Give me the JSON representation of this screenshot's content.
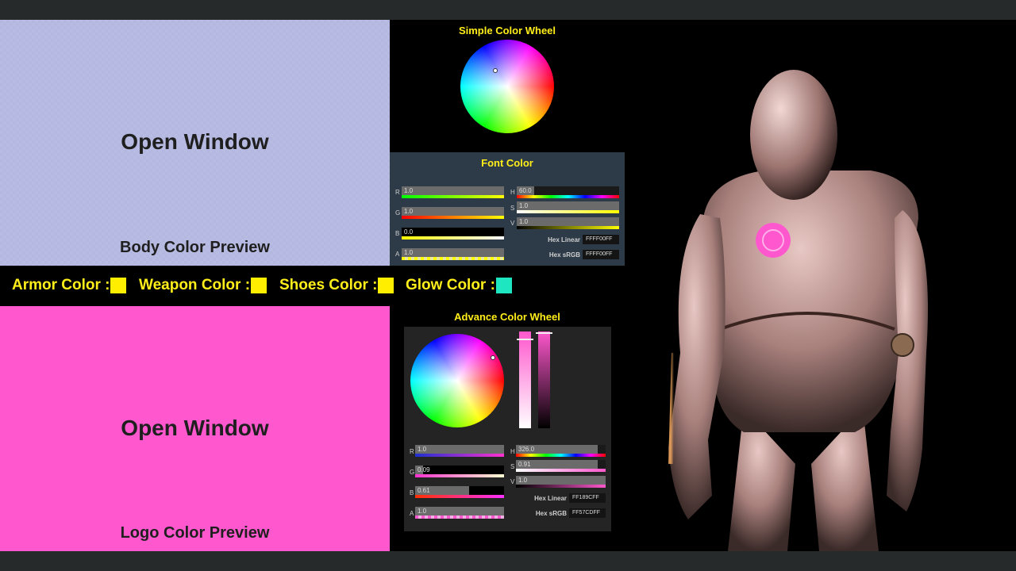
{
  "colors": {
    "body": "#b4b8e0",
    "logo": "#ff57cd",
    "label_yellow": "#ffee1a",
    "armor": "#ffee00",
    "weapon": "#ffee00",
    "shoes": "#ffee00",
    "glow": "#1ee6c0"
  },
  "body_preview": {
    "button": "Open Window",
    "label": "Body Color Preview"
  },
  "logo_preview": {
    "button": "Open Window",
    "label": "Logo Color Preview"
  },
  "swatches": [
    {
      "label": "Armor Color :"
    },
    {
      "label": "Weapon Color :"
    },
    {
      "label": "Shoes Color :"
    },
    {
      "label": "Glow Color :"
    }
  ],
  "simple_wheel": {
    "title": "Simple Color Wheel"
  },
  "font_color": {
    "title": "Font Color",
    "rgba": [
      {
        "letter": "R",
        "value": "1.0",
        "level": 1.0
      },
      {
        "letter": "G",
        "value": "1.0",
        "level": 1.0
      },
      {
        "letter": "B",
        "value": "0.0",
        "level": 0.0
      },
      {
        "letter": "A",
        "value": "1.0",
        "level": 1.0
      }
    ],
    "hsv": [
      {
        "letter": "H",
        "value": "60.0",
        "level": 0.17
      },
      {
        "letter": "S",
        "value": "1.0",
        "level": 1.0
      },
      {
        "letter": "V",
        "value": "1.0",
        "level": 1.0
      }
    ],
    "hex_linear_label": "Hex Linear",
    "hex_linear": "FFFF00FF",
    "hex_srgb_label": "Hex sRGB",
    "hex_srgb": "FFFF00FF"
  },
  "advance_wheel": {
    "title": "Advance Color Wheel",
    "rgba": [
      {
        "letter": "R",
        "value": "1.0",
        "level": 1.0
      },
      {
        "letter": "G",
        "value": "0.09",
        "level": 0.09
      },
      {
        "letter": "B",
        "value": "0.61",
        "level": 0.61
      },
      {
        "letter": "A",
        "value": "1.0",
        "level": 1.0
      }
    ],
    "hsv": [
      {
        "letter": "H",
        "value": "326.0",
        "level": 0.91
      },
      {
        "letter": "S",
        "value": "0.91",
        "level": 0.91
      },
      {
        "letter": "V",
        "value": "1.0",
        "level": 1.0
      }
    ],
    "hex_linear_label": "Hex Linear",
    "hex_linear": "FF189CFF",
    "hex_srgb_label": "Hex sRGB",
    "hex_srgb": "FF57CDFF"
  }
}
